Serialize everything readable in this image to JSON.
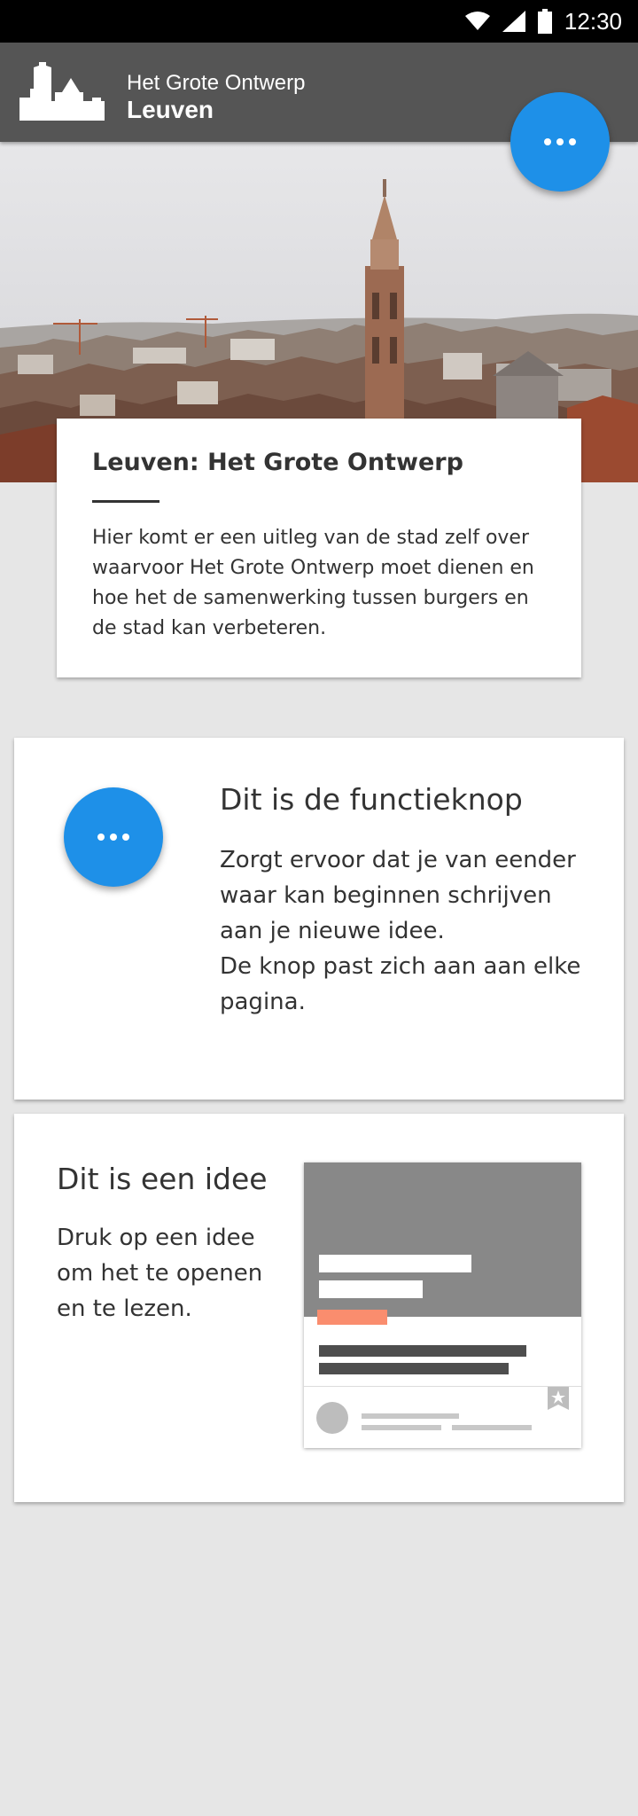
{
  "status_bar": {
    "time": "12:30",
    "icons": [
      "wifi-icon",
      "signal-icon",
      "battery-icon"
    ]
  },
  "app_bar": {
    "brand_sub": "Het Grote Ontwerp",
    "brand_main": "Leuven",
    "logo_icon": "city-skyline-logo",
    "background_color": "#555555"
  },
  "fab": {
    "icon": "more-horizontal-icon",
    "color": "#1e90e8"
  },
  "hero": {
    "description_icon": "leuven-city-photo"
  },
  "intro_card": {
    "title": "Leuven: Het Grote Ontwerp",
    "text": "Hier komt er een uitleg van de stad zelf over waarvoor Het Grote Ontwerp moet dienen en hoe het de samenwerking tussen burgers en de stad kan verbeteren."
  },
  "function_card": {
    "title": "Dit is de functieknop",
    "text_line1": "Zorgt ervoor dat je van eender waar kan beginnen schrijven aan je nieuwe idee.",
    "text_line2": "De knop past zich aan aan elke pagina."
  },
  "idea_card": {
    "title": "Dit is een idee",
    "text": "Druk op een idee om het te openen en te lezen.",
    "tag_color": "#fa8d6e"
  }
}
